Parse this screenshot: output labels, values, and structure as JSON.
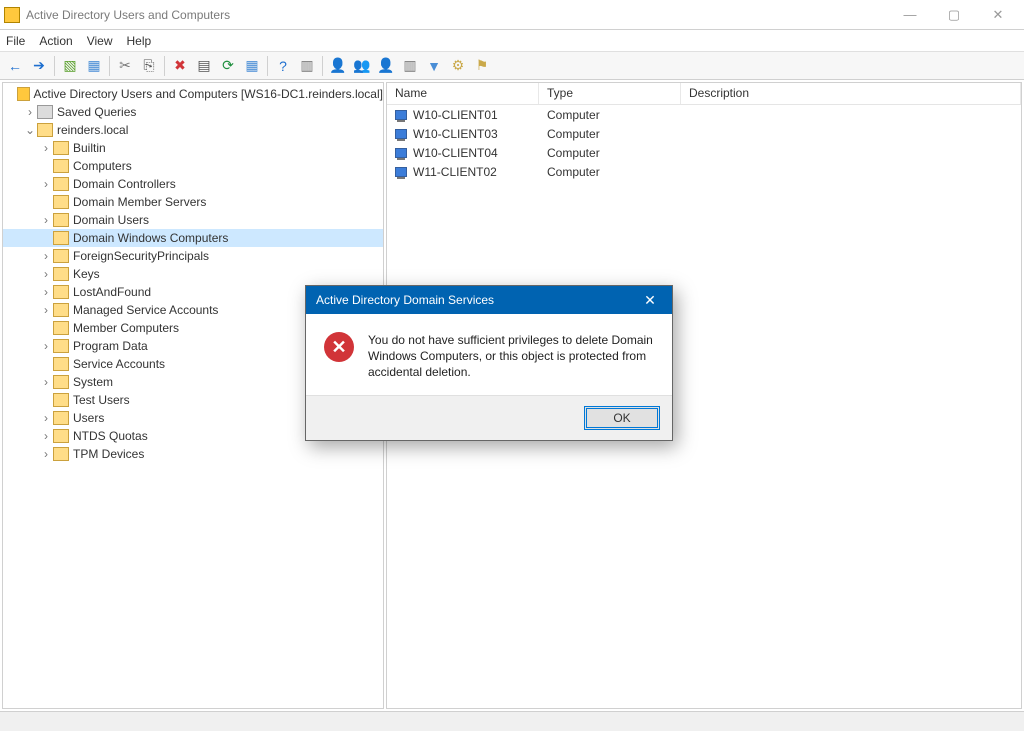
{
  "window": {
    "title": "Active Directory Users and Computers"
  },
  "menu": {
    "file": "File",
    "action": "Action",
    "view": "View",
    "help": "Help"
  },
  "toolbar_icons": {
    "back": "←",
    "forward": "➔",
    "up": "▧",
    "show": "▦",
    "cut": "✂",
    "copy": "⎘",
    "delete": "✖",
    "properties": "▤",
    "refresh": "⟳",
    "export": "▦",
    "help": "?",
    "find": "▥",
    "user": "👤",
    "users": "👥",
    "userg": "👤",
    "addobj": "▥",
    "filter": "▼",
    "opts": "⚙",
    "more": "⚑"
  },
  "tree": {
    "root": "Active Directory Users and Computers [WS16-DC1.reinders.local]",
    "saved_queries": "Saved Queries",
    "domain": "reinders.local",
    "items": [
      "Builtin",
      "Computers",
      "Domain Controllers",
      "Domain Member Servers",
      "Domain Users",
      "Domain Windows Computers",
      "ForeignSecurityPrincipals",
      "Keys",
      "LostAndFound",
      "Managed Service Accounts",
      "Member Computers",
      "Program Data",
      "Service Accounts",
      "System",
      "Test Users",
      "Users",
      "NTDS Quotas",
      "TPM Devices"
    ]
  },
  "list": {
    "cols": {
      "name": "Name",
      "type": "Type",
      "desc": "Description"
    },
    "rows": [
      {
        "name": "W10-CLIENT01",
        "type": "Computer"
      },
      {
        "name": "W10-CLIENT03",
        "type": "Computer"
      },
      {
        "name": "W10-CLIENT04",
        "type": "Computer"
      },
      {
        "name": "W11-CLIENT02",
        "type": "Computer"
      }
    ]
  },
  "dialog": {
    "title": "Active Directory Domain Services",
    "message": "You do not have sufficient privileges to delete Domain Windows Computers, or this object is protected from accidental deletion.",
    "ok": "OK"
  }
}
